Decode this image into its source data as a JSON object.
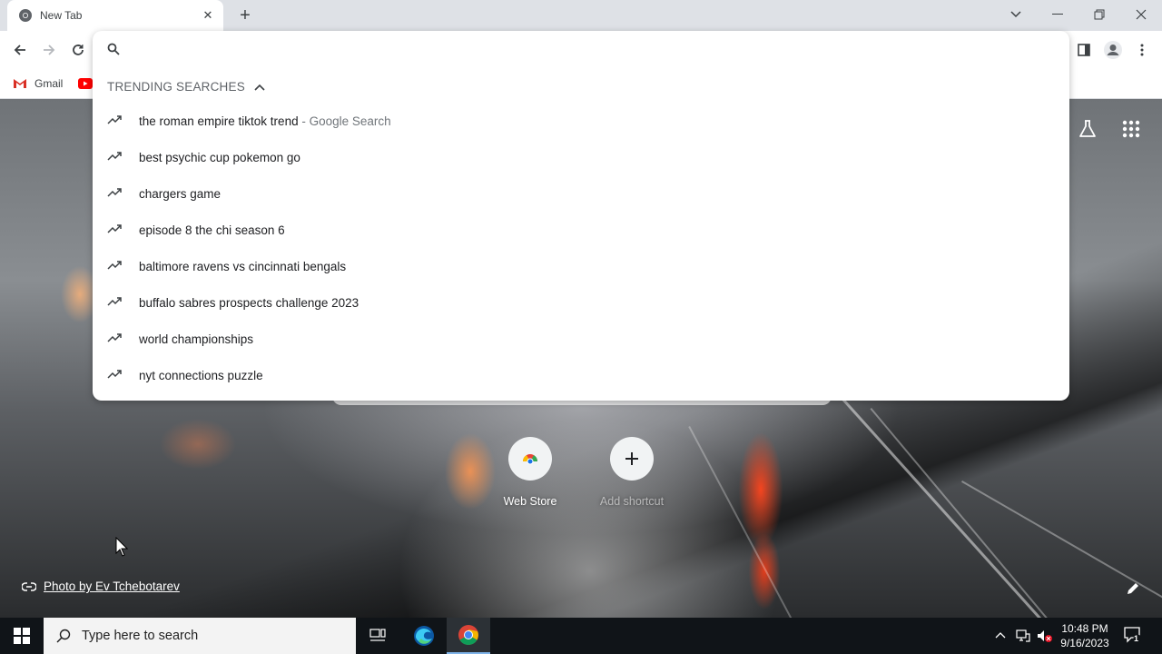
{
  "browser": {
    "tab_title": "New Tab",
    "bookmarks": [
      {
        "label": "Gmail"
      }
    ]
  },
  "omnibox": {
    "value": "",
    "placeholder": "",
    "heading": "TRENDING SEARCHES",
    "suggestions": [
      {
        "text": "the roman empire tiktok trend",
        "sub": " - Google Search"
      },
      {
        "text": "best psychic cup pokemon go",
        "sub": ""
      },
      {
        "text": "chargers game",
        "sub": ""
      },
      {
        "text": "episode 8 the chi season 6",
        "sub": ""
      },
      {
        "text": "baltimore ravens vs cincinnati bengals",
        "sub": ""
      },
      {
        "text": "buffalo sabres prospects challenge 2023",
        "sub": ""
      },
      {
        "text": "world championships",
        "sub": ""
      },
      {
        "text": "nyt connections puzzle",
        "sub": ""
      }
    ]
  },
  "ntp": {
    "shortcuts": [
      {
        "label": "Web Store"
      },
      {
        "label": "Add shortcut"
      }
    ],
    "photo_credit": "Photo by Ev Tchebotarev"
  },
  "taskbar": {
    "search_placeholder": "Type here to search",
    "time": "10:48 PM",
    "date": "9/16/2023",
    "notification_count": "1"
  },
  "colors": {
    "accent_blue": "#1a73e8",
    "taskbar": "#101418"
  }
}
